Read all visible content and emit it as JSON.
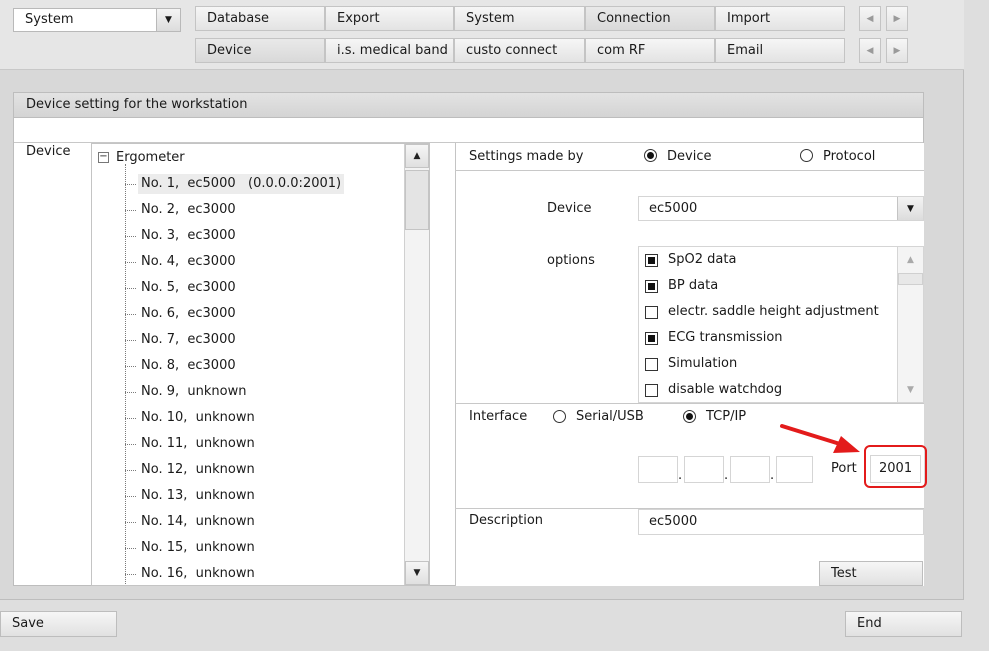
{
  "top_select": {
    "value": "System"
  },
  "tabs_row1": [
    "Database",
    "Export",
    "System",
    "Connection",
    "Import"
  ],
  "tabs_row2": [
    "Device",
    "i.s. medical band",
    "custo connect",
    "com RF",
    "Email"
  ],
  "section_title": "Device setting for the workstation",
  "device_label": "Device",
  "tree": {
    "root": "Ergometer",
    "items": [
      "No. 1,  ec5000   (0.0.0.0:2001)",
      "No. 2,  ec3000",
      "No. 3,  ec3000",
      "No. 4,  ec3000",
      "No. 5,  ec3000",
      "No. 6,  ec3000",
      "No. 7,  ec3000",
      "No. 8,  ec3000",
      "No. 9,  unknown",
      "No. 10,  unknown",
      "No. 11,  unknown",
      "No. 12,  unknown",
      "No. 13,  unknown",
      "No. 14,  unknown",
      "No. 15,  unknown",
      "No. 16,  unknown"
    ]
  },
  "settings": {
    "made_by_label": "Settings made by",
    "radio_device": "Device",
    "radio_protocol": "Protocol",
    "device_field_label": "Device",
    "device_value": "ec5000",
    "options_label": "options",
    "options": [
      {
        "label": "SpO2 data",
        "checked": true
      },
      {
        "label": "BP data",
        "checked": true
      },
      {
        "label": "electr. saddle height adjustment",
        "checked": false
      },
      {
        "label": "ECG transmission",
        "checked": true
      },
      {
        "label": "Simulation",
        "checked": false
      },
      {
        "label": "disable watchdog",
        "checked": false
      }
    ],
    "interface_label": "Interface",
    "radio_serial": "Serial/USB",
    "radio_tcpip": "TCP/IP",
    "port_label": "Port",
    "port_value": "2001",
    "description_label": "Description",
    "description_value": "ec5000",
    "test_button": "Test"
  },
  "footer": {
    "save": "Save",
    "end": "End"
  },
  "colors": {
    "highlight": "#e31b1b"
  }
}
